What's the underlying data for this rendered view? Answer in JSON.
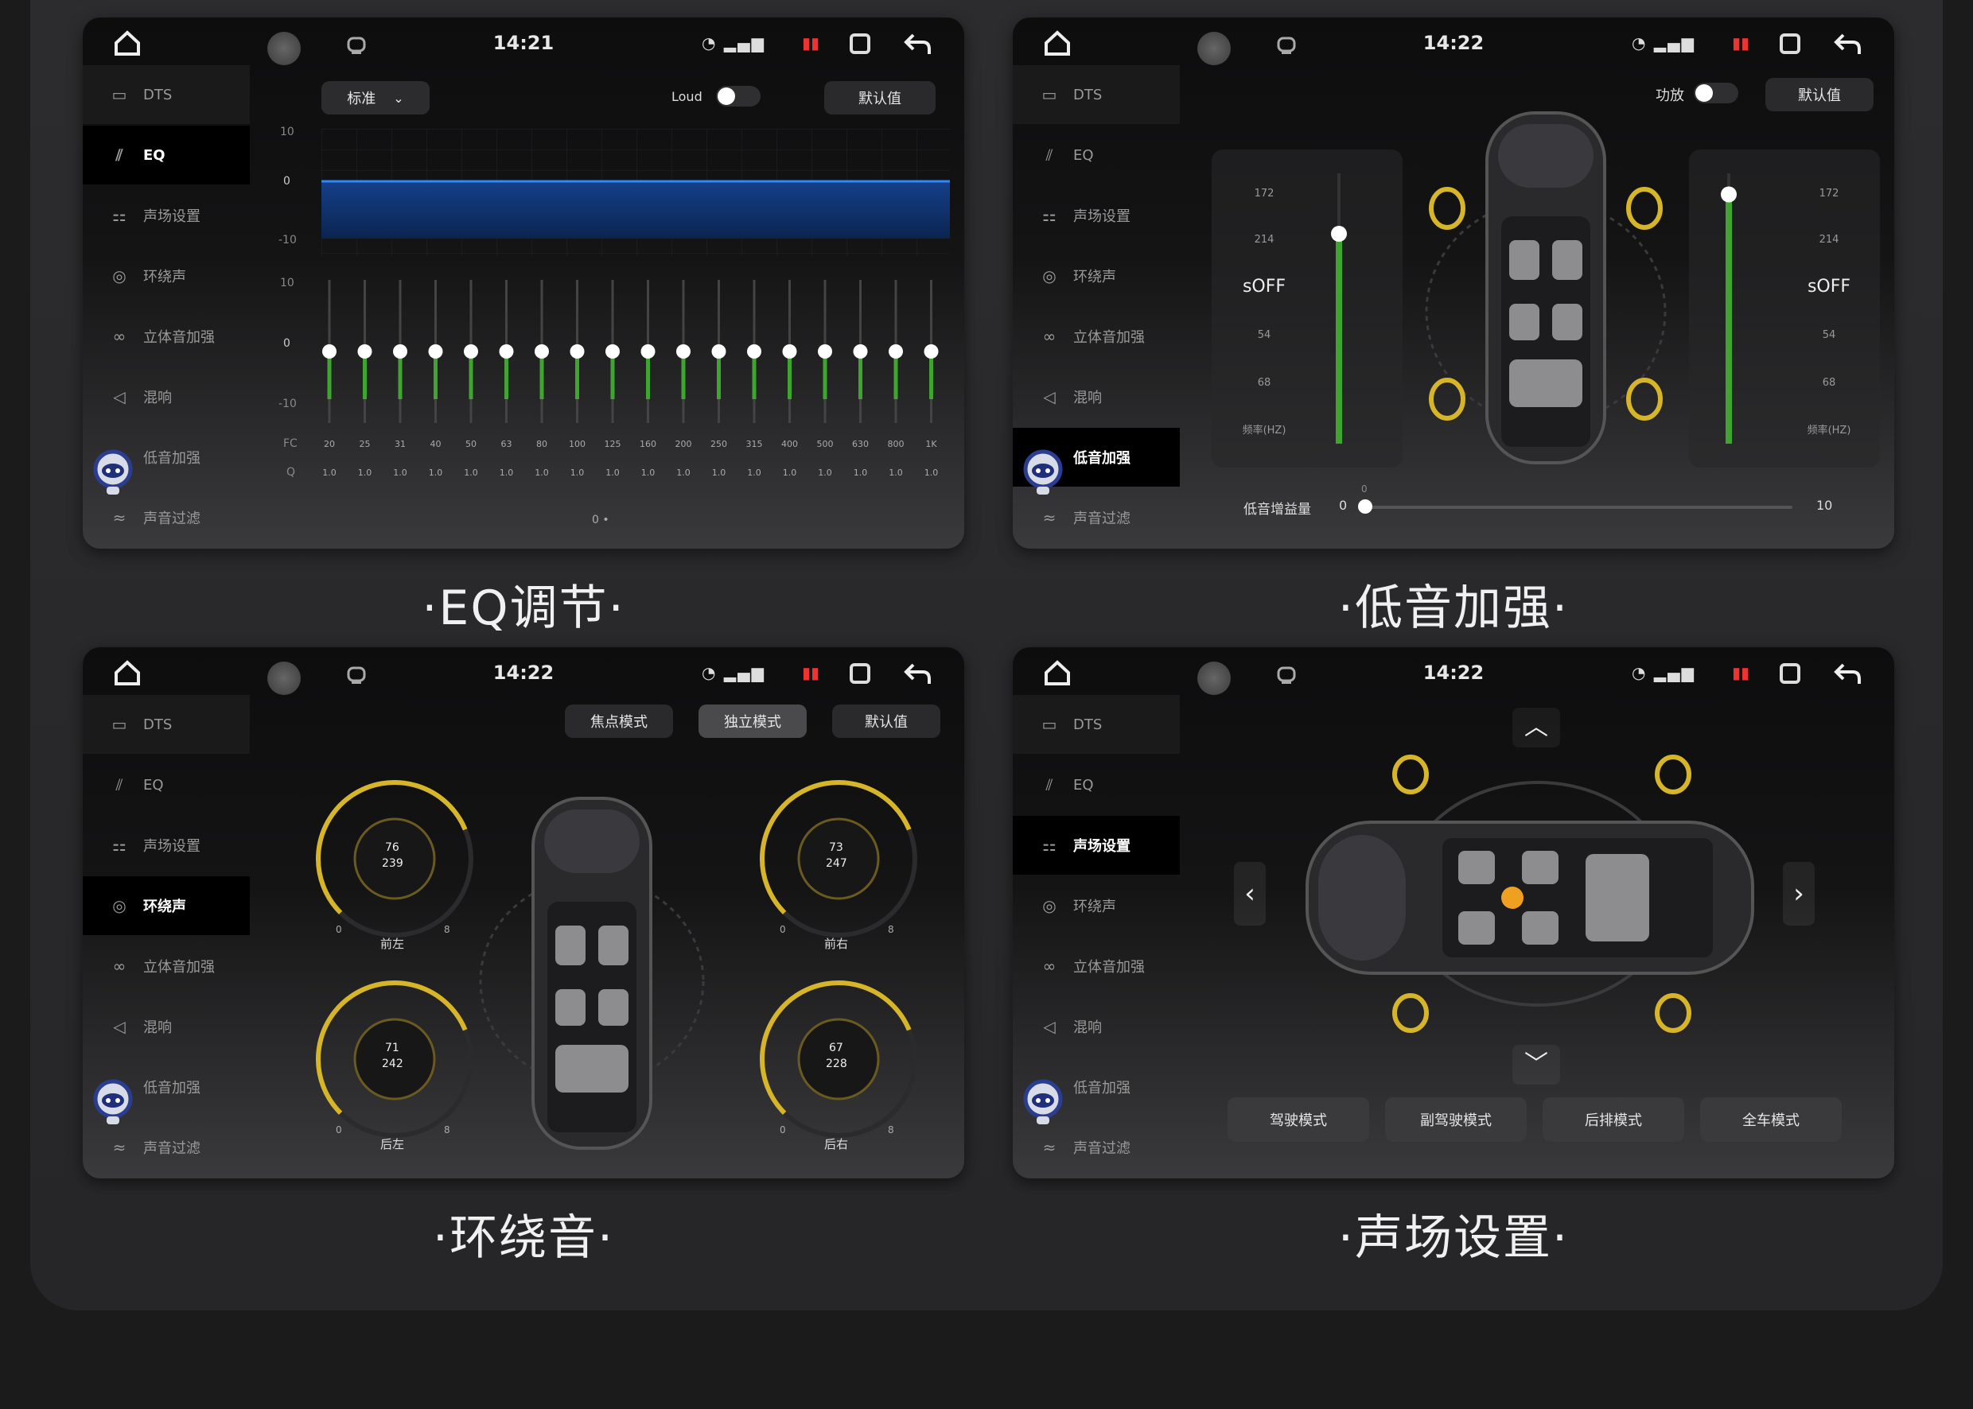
{
  "status": {
    "time_1": "14:21",
    "time_2": "14:22",
    "time_3": "14:22",
    "time_4": "14:22"
  },
  "sidebar": {
    "items": [
      {
        "label": "DTS"
      },
      {
        "label": "EQ"
      },
      {
        "label": "声场设置"
      },
      {
        "label": "环绕声"
      },
      {
        "label": "立体音加强"
      },
      {
        "label": "混响"
      },
      {
        "label": "低音加强"
      },
      {
        "label": "声音过滤"
      }
    ]
  },
  "captions": {
    "eq": "·EQ调节·",
    "bass": "·低音加强·",
    "surround": "·环绕音·",
    "soundfield": "·声场设置·"
  },
  "eq_panel": {
    "preset": "标准",
    "loud_label": "Loud",
    "default_button": "默认值",
    "top_axis": [
      "10",
      "0",
      "-10"
    ],
    "slider_axis": [
      "10",
      "0",
      "-10"
    ],
    "fc_label": "FC",
    "q_label": "Q",
    "fc_values": [
      "20",
      "25",
      "31",
      "40",
      "50",
      "63",
      "80",
      "100",
      "125",
      "160",
      "200",
      "250",
      "315",
      "400",
      "500",
      "630",
      "800",
      "1K"
    ],
    "q_values": [
      "1.0",
      "1.0",
      "1.0",
      "1.0",
      "1.0",
      "1.0",
      "1.0",
      "1.0",
      "1.0",
      "1.0",
      "1.0",
      "1.0",
      "1.0",
      "1.0",
      "1.0",
      "1.0",
      "1.0",
      "1.0"
    ],
    "slider_levels": [
      0,
      0,
      0,
      0,
      0,
      0,
      0,
      0,
      0,
      0,
      0,
      0,
      0,
      0,
      0,
      0,
      0,
      0
    ],
    "page_indicator": "0 •"
  },
  "bass_panel": {
    "switch_label": "功放",
    "default_button": "默认值",
    "left_scale": [
      "172",
      "214",
      "sOFF",
      "54",
      "68",
      "频率(HZ)"
    ],
    "right_scale": [
      "172",
      "214",
      "sOFF",
      "54",
      "68",
      "频率(HZ)"
    ],
    "gain_label": "低音增益量",
    "gain_min": "0",
    "gain_max": "10",
    "gain_value": "0",
    "left_level": 0.8,
    "right_level": 0.95
  },
  "surround_panel": {
    "mode_focus": "焦点模式",
    "mode_independent": "独立模式",
    "default_button": "默认值",
    "dials": [
      {
        "label": "前左",
        "v1": "76",
        "v2": "239",
        "min": "0",
        "max": "8",
        "level": 0.75
      },
      {
        "label": "前右",
        "v1": "73",
        "v2": "247",
        "min": "0",
        "max": "8",
        "level": 0.75
      },
      {
        "label": "后左",
        "v1": "71",
        "v2": "242",
        "min": "0",
        "max": "8",
        "level": 0.75
      },
      {
        "label": "后右",
        "v1": "67",
        "v2": "228",
        "min": "0",
        "max": "8",
        "level": 0.75
      }
    ]
  },
  "soundfield_panel": {
    "modes": [
      "驾驶模式",
      "副驾驶模式",
      "后排模式",
      "全车模式"
    ]
  },
  "colors": {
    "accent_blue": "#1b6fd6",
    "eq_green": "#3ea52f",
    "speaker_gold": "#d6b528",
    "highlight_orange": "#f0a020"
  }
}
